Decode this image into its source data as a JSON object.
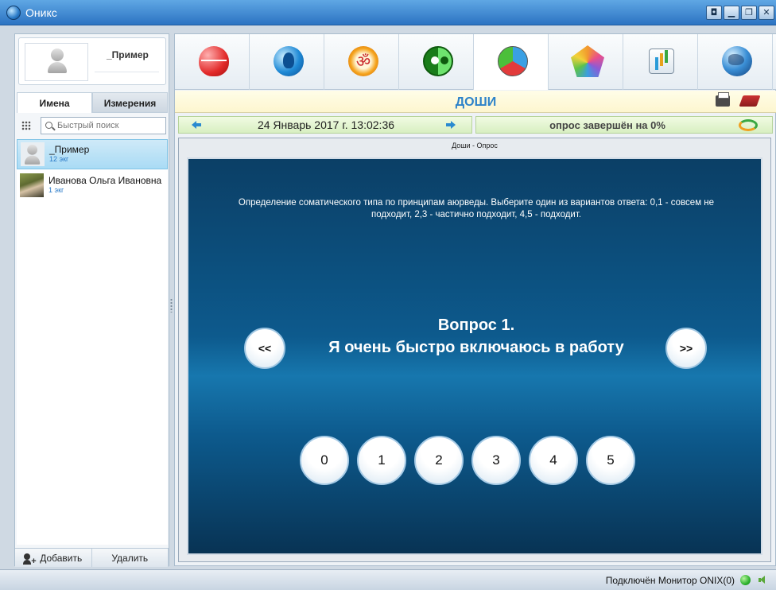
{
  "window": {
    "title": "Оникс",
    "buttons": [
      "◘",
      "▁",
      "❐",
      "✕"
    ]
  },
  "profile": {
    "name": "_Пример"
  },
  "tabs": {
    "names": "Имена",
    "measurements": "Измерения"
  },
  "search": {
    "placeholder": "Быстрый поиск",
    "value": ""
  },
  "patients": [
    {
      "name": "_Пример",
      "count": "12 экг",
      "selected": true
    },
    {
      "name": "Иванова Ольга Ивановна",
      "count": "1 экг",
      "selected": false
    }
  ],
  "actions": {
    "add": "Добавить",
    "delete": "Удалить"
  },
  "toolbar": {
    "icons": [
      "heart-ecg-icon",
      "head-icon",
      "om-icon",
      "yin-yang-icon",
      "tridosha-icon",
      "pentagon-icon",
      "bar-chart-icon",
      "globe-icon"
    ],
    "om_glyph": "ॐ",
    "active_index": 4
  },
  "section": {
    "title": "ДОШИ"
  },
  "nav": {
    "datetime": "24 Январь 2017 г. 13:02:36",
    "progress": "опрос завершён на 0%",
    "progress_percent": 0
  },
  "panel": {
    "title": "Доши - Опрос",
    "instruction": "Определение соматического типа по принципам аюрведы. Выберите один из вариантов ответа: 0,1 - совсем не подходит, 2,3 - частично подходит, 4,5 - подходит.",
    "question_number": "Вопрос 1.",
    "question_text": "Я очень быстро включаюсь в работу",
    "prev": "<<",
    "next": ">>",
    "answers": [
      "0",
      "1",
      "2",
      "3",
      "4",
      "5"
    ]
  },
  "status": {
    "text": "Подключён Монитор ONIX(0)",
    "connected_color": "#2db22d"
  }
}
